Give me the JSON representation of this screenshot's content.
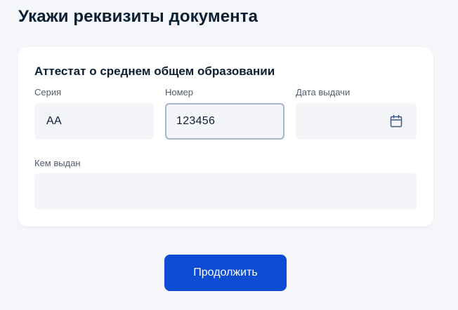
{
  "page": {
    "title": "Укажи реквизиты документа"
  },
  "form": {
    "title": "Аттестат о среднем общем образовании",
    "series": {
      "label": "Серия",
      "value": "АА"
    },
    "number": {
      "label": "Номер",
      "value": "123456"
    },
    "issue_date": {
      "label": "Дата выдачи",
      "value": "",
      "icon": "calendar-icon"
    },
    "issued_by": {
      "label": "Кем выдан",
      "value": ""
    }
  },
  "actions": {
    "continue_label": "Продолжить"
  },
  "colors": {
    "primary": "#0d4cd3",
    "background": "#f4f6fa",
    "field_bg": "#f4f5f8",
    "focus_border": "#a3b6cc",
    "text": "#0b1f33",
    "label": "#4f5c6b"
  }
}
